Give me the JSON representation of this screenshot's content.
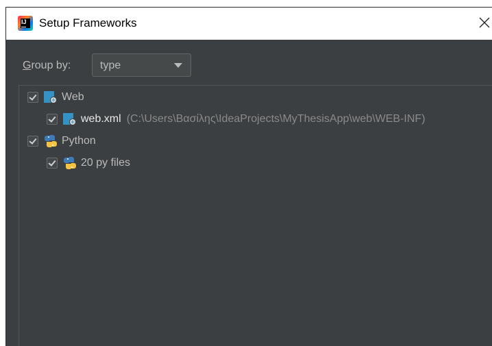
{
  "window": {
    "title": "Setup Frameworks",
    "app_icon_text": "IJ"
  },
  "toolbar": {
    "group_by_prefix": "G",
    "group_by_rest": "roup by:",
    "group_by_value": "type"
  },
  "tree": {
    "web": {
      "label": "Web",
      "checked": true,
      "icon": "web-framework-icon"
    },
    "web_xml": {
      "label": "web.xml",
      "path": "(C:\\Users\\Βασίλης\\IdeaProjects\\MyThesisApp\\web\\WEB-INF)",
      "checked": true,
      "icon": "web-xml-icon"
    },
    "python": {
      "label": "Python",
      "checked": true,
      "icon": "python-icon"
    },
    "py_files": {
      "label": "20 py files",
      "checked": true,
      "icon": "python-icon"
    }
  },
  "colors": {
    "dialog_bg": "#3c3f41",
    "text": "#bbbbbb",
    "path_text": "#8a8a8a",
    "web_icon": "#3592c4",
    "python_blue": "#3d7ab8",
    "python_yellow": "#f5c242"
  }
}
